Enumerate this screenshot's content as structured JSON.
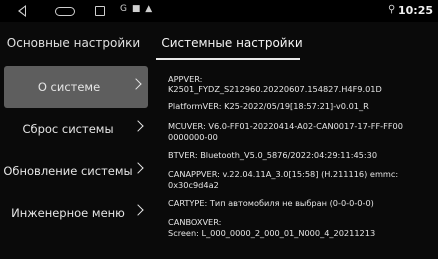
{
  "status_bar": {
    "icons": "G ■ ▲",
    "location_icon": "location-pin-icon",
    "time": "10:25"
  },
  "tabs": {
    "basic": "Основные настройки",
    "system": "Системные настройки"
  },
  "sidebar": {
    "items": [
      {
        "label": "О системе",
        "active": true
      },
      {
        "label": "Сброс системы",
        "active": false
      },
      {
        "label": "Обновление системы",
        "active": false
      },
      {
        "label": "Инженерное меню",
        "active": false
      }
    ]
  },
  "info": {
    "appver_label": "APPVER:",
    "appver_value": "K2501_FYDZ_S212960.20220607.154827.H4F9.01D",
    "platformver": "PlatformVER: K25-2022/05/19[18:57:21]-v0.01_R",
    "mcuver": "MCUVER: V6.0-FF01-20220414-A02-CAN0017-17-FF-FF00 0000000-00",
    "btver": "BTVER: Bluetooth_V5.0_5876/2022:04:29:11:45:30",
    "canappver": "CANAPPVER: v.22.04.11A_3.0[15:58] (H.211116)  emmc: 0x30c9d4a2",
    "cartype": "CARTYPE: Тип автомобиля не выбран  (0-0-0-0-0)",
    "canboxver_label": "CANBOXVER:",
    "screen": "Screen:  L_000_0000_2_000_01_N000_4_20211213"
  }
}
